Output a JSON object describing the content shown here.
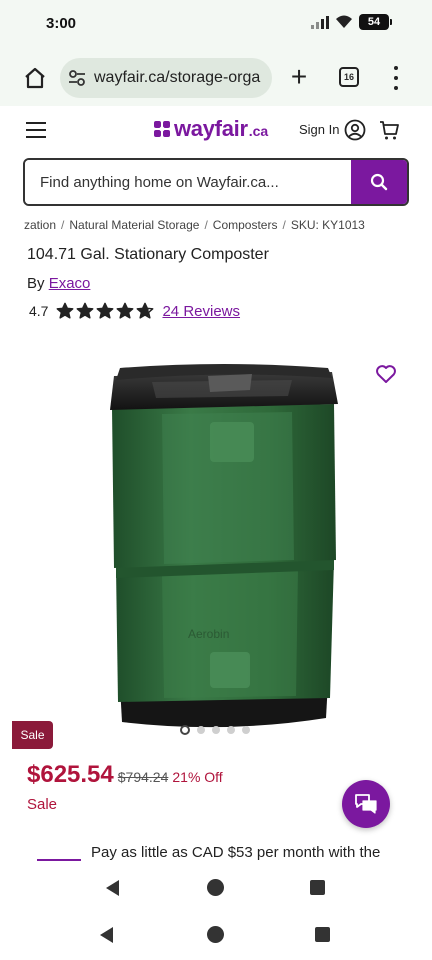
{
  "status_bar": {
    "time": "3:00",
    "battery": "54"
  },
  "browser": {
    "url": "wayfair.ca/storage-orga",
    "tab_count": "16"
  },
  "header": {
    "logo_word": "wayfair",
    "logo_tld": ".ca",
    "sign_in": "Sign In"
  },
  "search": {
    "placeholder": "Find anything home on Wayfair.ca..."
  },
  "breadcrumb": [
    "zation",
    "Natural Material Storage",
    "Composters",
    "SKU: KY1013"
  ],
  "product": {
    "title": "104.71 Gal. Stationary Composter",
    "by_label": "By",
    "brand": "Exaco",
    "rating": "4.7",
    "rating_value": 4.7,
    "reviews": "24 Reviews",
    "sale_badge": "Sale",
    "price": "$625.54",
    "old_price": "$794.24",
    "discount": "21% Off",
    "sale_label": "Sale",
    "image_count": 5,
    "active_image": 1
  },
  "financing": {
    "text": "Pay as little as CAD $53 per month with the"
  },
  "colors": {
    "brand": "#7b189f",
    "sale": "#b0143c",
    "sale_badge": "#8b1a3a",
    "composter": "#2f6a3a"
  }
}
